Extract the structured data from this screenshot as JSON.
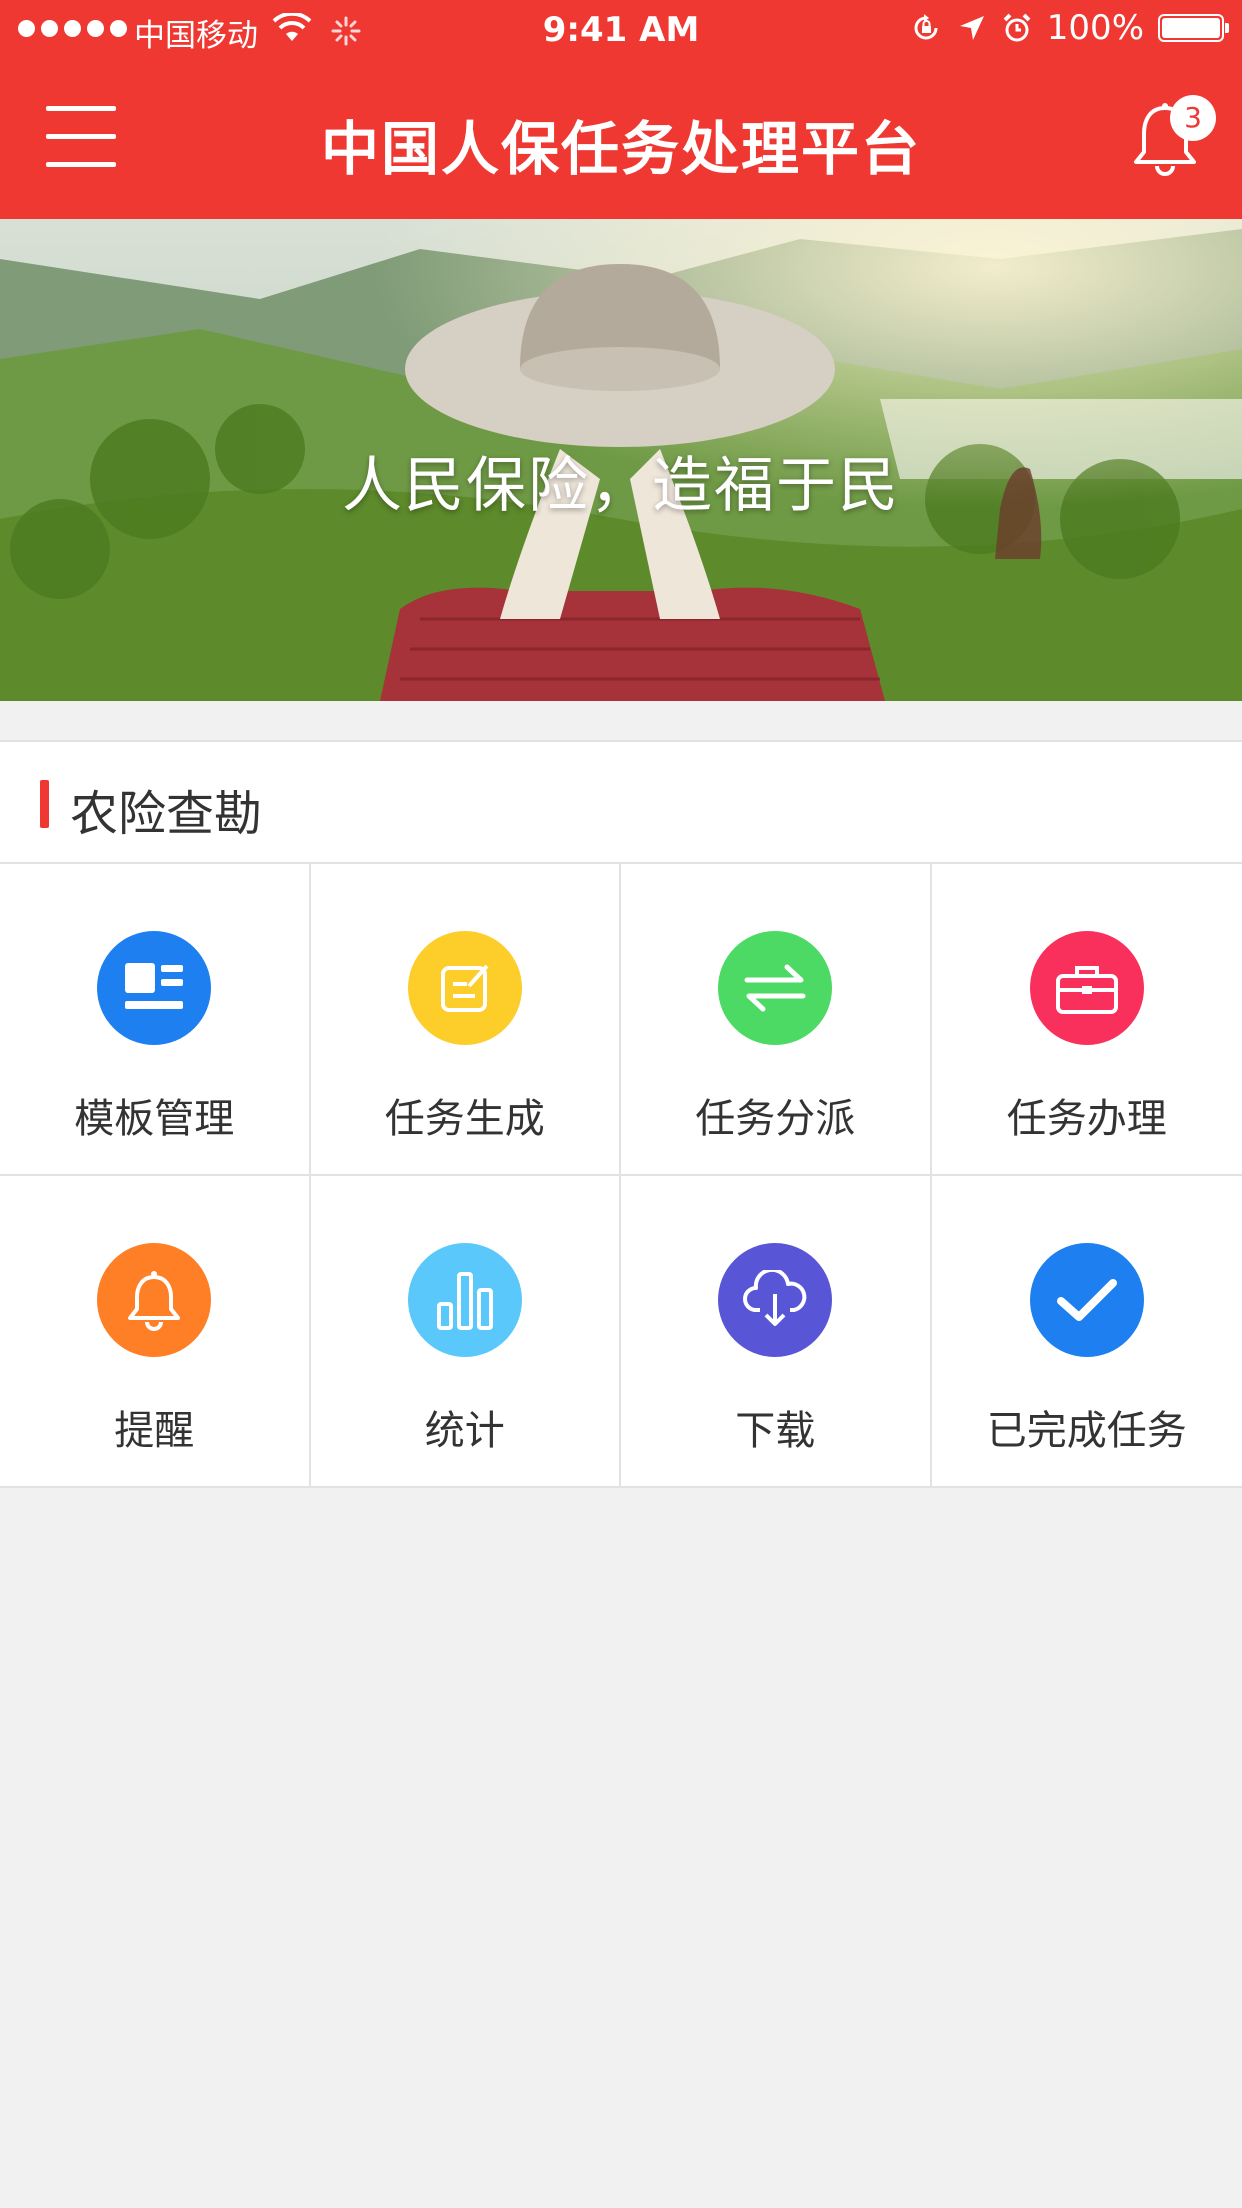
{
  "status_bar": {
    "carrier": "中国移动",
    "time": "9:41 AM",
    "battery": "100%",
    "battery_level": 1.0
  },
  "header": {
    "title": "中国人保任务处理平台",
    "notification_count": "3"
  },
  "banner": {
    "slogan": "人民保险，造福于民"
  },
  "section": {
    "title": "农险查勘"
  },
  "grid_items": [
    {
      "label": "模板管理",
      "icon": "template-icon",
      "color": "#1e7ff0"
    },
    {
      "label": "任务生成",
      "icon": "edit-icon",
      "color": "#fdcd2a"
    },
    {
      "label": "任务分派",
      "icon": "swap-arrows-icon",
      "color": "#4cd964"
    },
    {
      "label": "任务办理",
      "icon": "briefcase-icon",
      "color": "#f9305c"
    },
    {
      "label": "提醒",
      "icon": "bell-icon",
      "color": "#fe7f26"
    },
    {
      "label": "统计",
      "icon": "bar-chart-icon",
      "color": "#5ac8fa"
    },
    {
      "label": "下载",
      "icon": "cloud-download-icon",
      "color": "#5856d6"
    },
    {
      "label": "已完成任务",
      "icon": "checkmark-icon",
      "color": "#1e7ff0"
    }
  ],
  "colors": {
    "brand_red": "#ef3832",
    "page_background": "#f1f1f1"
  }
}
